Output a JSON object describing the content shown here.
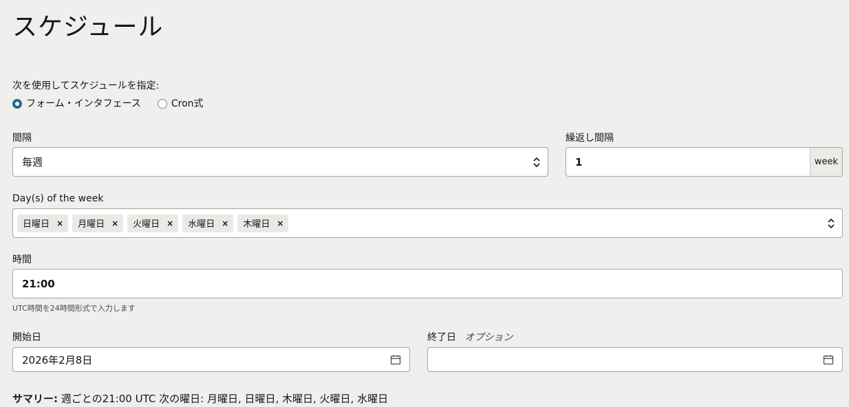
{
  "page": {
    "title": "スケジュール"
  },
  "schedule_using": {
    "label": "次を使用してスケジュールを指定:",
    "options": [
      {
        "label": "フォーム・インタフェース",
        "selected": true
      },
      {
        "label": "Cron式",
        "selected": false
      }
    ]
  },
  "interval": {
    "label": "間隔",
    "value": "毎週"
  },
  "repeat": {
    "label": "繰返し間隔",
    "value": "1",
    "unit": "week"
  },
  "days": {
    "label": "Day(s) of the week",
    "chips": [
      "日曜日",
      "月曜日",
      "火曜日",
      "水曜日",
      "木曜日"
    ],
    "remove_glyph": "×"
  },
  "time": {
    "label": "時間",
    "value": "21:00",
    "help": "UTC時間を24時間形式で入力します"
  },
  "start_date": {
    "label": "開始日",
    "value": "2026年2月8日"
  },
  "end_date": {
    "label": "終了日",
    "optional": "オプション",
    "value": ""
  },
  "summary": {
    "prefix": "サマリー:",
    "text": " 週ごとの21:00 UTC 次の曜日: 月曜日, 日曜日, 木曜日, 火曜日, 水曜日"
  },
  "colors": {
    "accent": "#1f6f8b",
    "background": "#f1efed",
    "border": "#a6a4a1",
    "chip": "#ebe9e6"
  }
}
